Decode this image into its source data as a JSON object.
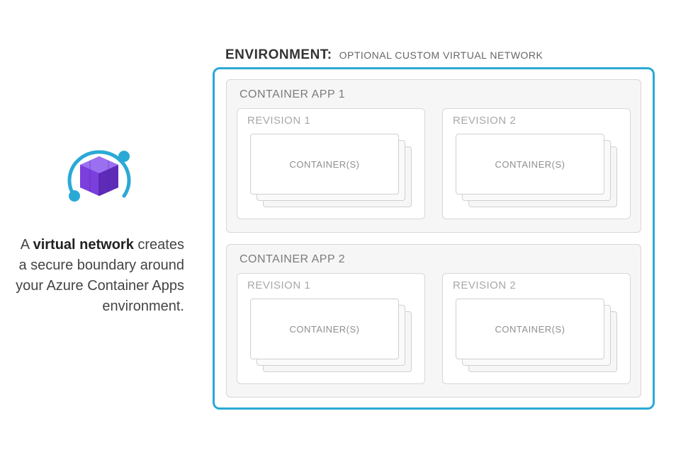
{
  "description": {
    "prefix": "A ",
    "bold": "virtual network",
    "rest": " creates a secure boundary around your Azure Container Apps environment."
  },
  "environment": {
    "label": "ENVIRONMENT:",
    "sublabel": "OPTIONAL CUSTOM VIRTUAL NETWORK",
    "apps": [
      {
        "title": "CONTAINER APP 1",
        "revisions": [
          {
            "title": "REVISION 1",
            "container_label": "CONTAINER(S)"
          },
          {
            "title": "REVISION 2",
            "container_label": "CONTAINER(S)"
          }
        ]
      },
      {
        "title": "CONTAINER APP 2",
        "revisions": [
          {
            "title": "REVISION 1",
            "container_label": "CONTAINER(S)"
          },
          {
            "title": "REVISION 2",
            "container_label": "CONTAINER(S)"
          }
        ]
      }
    ]
  }
}
